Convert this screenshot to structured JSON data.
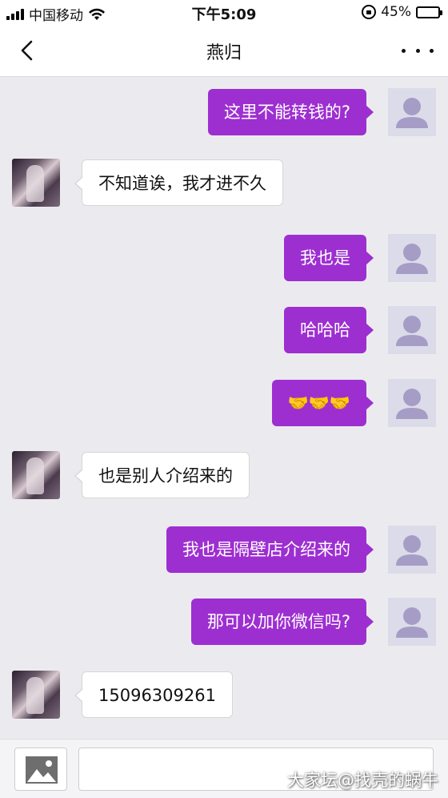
{
  "status_bar": {
    "carrier": "中国移动",
    "time": "下午5:09",
    "battery_percent_text": "45%",
    "battery_level": 0.45,
    "icons": [
      "signal-icon",
      "wifi-icon",
      "rotation-lock-icon",
      "battery-icon"
    ]
  },
  "header": {
    "title": "燕归",
    "back_icon": "chevron-left-icon",
    "more_icon": "more-dots-icon"
  },
  "messages": [
    {
      "sender": "me",
      "text": "这里不能转钱的?"
    },
    {
      "sender": "other",
      "text": "不知道诶，我才进不久"
    },
    {
      "sender": "me",
      "text": "我也是"
    },
    {
      "sender": "me",
      "text": "哈哈哈"
    },
    {
      "sender": "me",
      "text": "🤝🤝🤝"
    },
    {
      "sender": "other",
      "text": "也是别人介绍来的"
    },
    {
      "sender": "me",
      "text": "我也是隔壁店介绍来的"
    },
    {
      "sender": "me",
      "text": "那可以加你微信吗?"
    },
    {
      "sender": "other",
      "text": "15096309261"
    }
  ],
  "input_bar": {
    "image_button_icon": "image-icon",
    "value": "",
    "placeholder": ""
  },
  "watermark": "大家坛@找壳的蜗牛",
  "colors": {
    "my_bubble": "#9d2fd1",
    "other_bubble": "#ffffff",
    "background": "#ebebef"
  }
}
